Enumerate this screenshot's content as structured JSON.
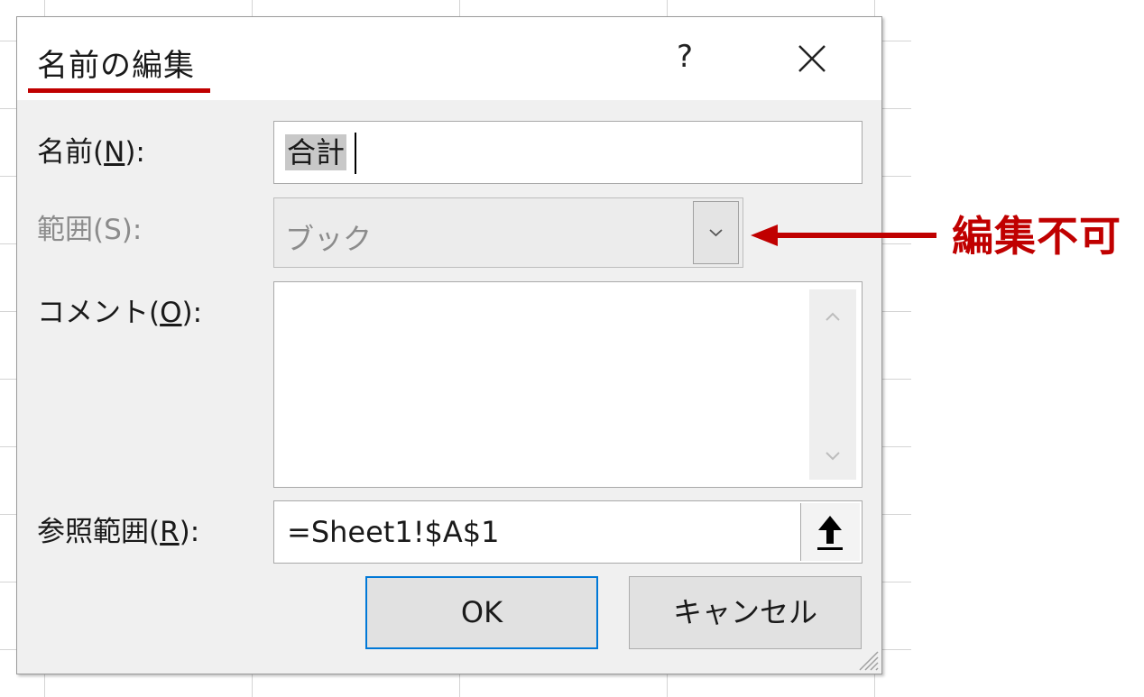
{
  "dialog": {
    "title": "名前の編集",
    "help_label": "?",
    "close_icon": "close-icon"
  },
  "fields": {
    "name": {
      "label_prefix": "名前(",
      "label_key": "N",
      "label_suffix": "):",
      "value": "合計"
    },
    "scope": {
      "label": "範囲(S):",
      "value": "ブック",
      "disabled": true,
      "icon": "chevron-down-icon"
    },
    "comment": {
      "label_prefix": "コメント(",
      "label_key": "O",
      "label_suffix": "):",
      "value": ""
    },
    "refers_to": {
      "label_prefix": "参照範囲(",
      "label_key": "R",
      "label_suffix": "):",
      "value": "=Sheet1!$A$1",
      "icon": "collapse-dialog-icon"
    }
  },
  "buttons": {
    "ok": "OK",
    "cancel": "キャンセル"
  },
  "annotation": {
    "text": "編集不可",
    "color": "#c00000"
  },
  "colors": {
    "accent": "#0078d7",
    "annotation": "#c00000"
  }
}
